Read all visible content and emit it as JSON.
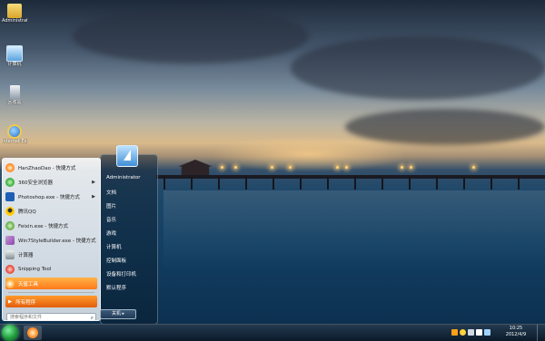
{
  "desktop": {
    "icons": [
      {
        "label": "Administrator",
        "icon": "user-folder-icon",
        "color": "#e8c14a"
      },
      {
        "label": "计算机",
        "icon": "computer-icon",
        "color": "#9fd3ff"
      },
      {
        "label": "回收站",
        "icon": "recycle-bin-icon",
        "color": "#c8d3de"
      },
      {
        "label": "Internet Explorer",
        "icon": "internet-explorer-icon",
        "color": "#3a8ee6"
      }
    ]
  },
  "start_menu": {
    "programs": [
      {
        "label": "HanZhaoDao - 快捷方式",
        "icon": "flower-icon",
        "color": "#ff8a2a"
      },
      {
        "label": "360安全浏览器",
        "icon": "browser-360-icon",
        "color": "#3cb043",
        "submenu": true
      },
      {
        "label": "Photoshop.exe - 快捷方式",
        "icon": "photoshop-icon",
        "color": "#1e5fb3",
        "submenu": true
      },
      {
        "label": "腾讯QQ",
        "icon": "qq-icon",
        "color": "#ffcc00"
      },
      {
        "label": "Feixin.exe - 快捷方式",
        "icon": "feixin-icon",
        "color": "#6ab04c"
      },
      {
        "label": "Win7StyleBuilder.exe - 快捷方式",
        "icon": "style-builder-icon",
        "color": "#8e44ad"
      },
      {
        "label": "计算器",
        "icon": "calculator-icon",
        "color": "#7f8c8d"
      },
      {
        "label": "Snipping Tool",
        "icon": "scissors-icon",
        "color": "#e74c3c"
      },
      {
        "label": "天星工具",
        "icon": "tool-icon",
        "color": "#ffb347"
      }
    ],
    "all_programs": "所有程序",
    "search_placeholder": "搜索程序和文件",
    "user_name": "Administrator",
    "right_items": [
      "文档",
      "图片",
      "音乐",
      "游戏",
      "计算机",
      "控制面板",
      "设备和打印机",
      "默认程序"
    ],
    "shutdown_label": "关机"
  },
  "taskbar": {
    "time": "10:25",
    "date": "2012/4/9",
    "tray_icons": [
      {
        "icon": "tray-app-icon",
        "color": "#ff9f1a"
      },
      {
        "icon": "tray-qq-icon",
        "color": "#ffd33d"
      },
      {
        "icon": "tray-network-icon",
        "color": "#cfd8e3"
      },
      {
        "icon": "tray-flag-icon",
        "color": "#ffffff"
      },
      {
        "icon": "tray-volume-icon",
        "color": "#9fd3ff"
      }
    ]
  }
}
